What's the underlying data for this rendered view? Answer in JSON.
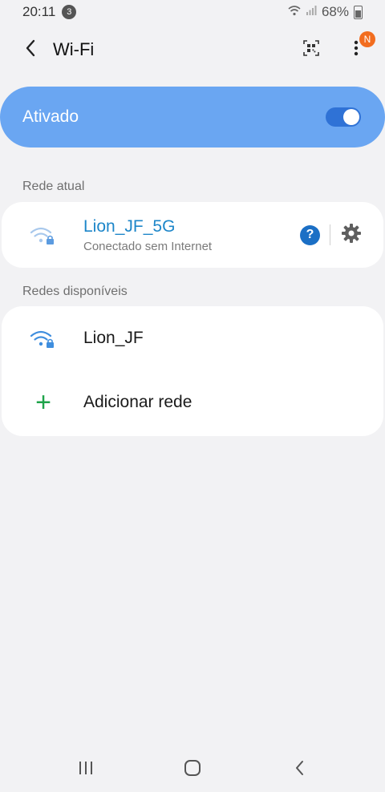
{
  "status_bar": {
    "time": "20:11",
    "notification_count": "3",
    "battery": "68%"
  },
  "app_bar": {
    "title": "Wi-Fi",
    "menu_badge": "N"
  },
  "master": {
    "label": "Ativado",
    "enabled": true
  },
  "current_section": {
    "header": "Rede atual",
    "network": {
      "name": "Lion_JF_5G",
      "status": "Conectado sem Internet"
    }
  },
  "available_section": {
    "header": "Redes disponíveis",
    "networks": [
      {
        "name": "Lion_JF"
      }
    ],
    "add_label": "Adicionar rede"
  },
  "colors": {
    "accent": "#6aa6f2",
    "connected_name": "#1d86c9",
    "add_icon": "#1ea34a",
    "badge": "#f26d1f"
  },
  "icons": [
    "back-icon",
    "qr-code-icon",
    "more-vert-icon",
    "wifi-lock-icon",
    "help-icon",
    "gear-icon",
    "plus-icon",
    "recents-icon",
    "home-icon",
    "nav-back-icon"
  ]
}
